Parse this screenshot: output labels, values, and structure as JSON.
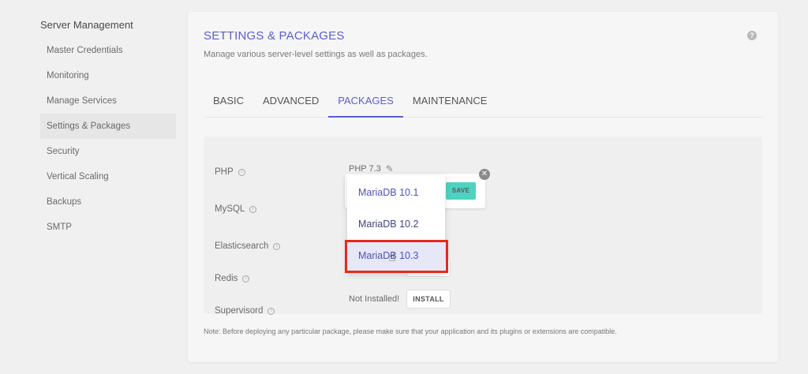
{
  "sidebar": {
    "title": "Server Management",
    "items": [
      {
        "label": "Master Credentials"
      },
      {
        "label": "Monitoring"
      },
      {
        "label": "Manage Services"
      },
      {
        "label": "Settings & Packages"
      },
      {
        "label": "Security"
      },
      {
        "label": "Vertical Scaling"
      },
      {
        "label": "Backups"
      },
      {
        "label": "SMTP"
      }
    ],
    "active_item": "Settings & Packages"
  },
  "card": {
    "title": "SETTINGS & PACKAGES",
    "subtitle": "Manage various server-level settings as well as packages.",
    "help_icon": "question-circle-icon"
  },
  "tabs": [
    {
      "label": "BASIC"
    },
    {
      "label": "ADVANCED"
    },
    {
      "label": "PACKAGES"
    },
    {
      "label": "MAINTENANCE"
    }
  ],
  "active_tab": "PACKAGES",
  "packages": {
    "php": {
      "label": "PHP",
      "value": "PHP 7.3"
    },
    "mysql": {
      "label": "MySQL"
    },
    "elasticsearch": {
      "label": "Elasticsearch"
    },
    "redis": {
      "label": "Redis"
    },
    "supervisord": {
      "label": "Supervisord",
      "status": "Not Installed!",
      "button": "INSTALL"
    }
  },
  "mysql_popover": {
    "save_label": "SAVE",
    "options": [
      "MariaDB 10.1",
      "MariaDB 10.2",
      "MariaDB 10.3"
    ],
    "hovered_option": "MariaDB 10.3"
  },
  "note": "Note: Before deploying any particular package, please make sure that your application and its plugins or extensions are compatible.",
  "colors": {
    "accent": "#5b5fc7",
    "save": "#4ed2c2",
    "highlight": "#e8291b"
  }
}
